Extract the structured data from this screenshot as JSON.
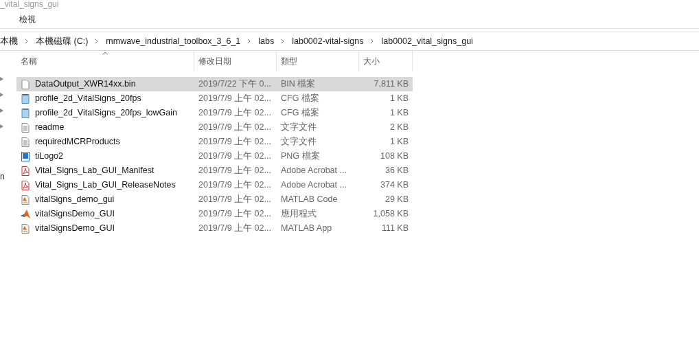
{
  "window": {
    "title": "_vital_signs_gui"
  },
  "ribbon_tabs": [
    {
      "label": "檢視",
      "selected": false
    }
  ],
  "breadcrumb": [
    "本機",
    "本機磁碟 (C:)",
    "mmwave_industrial_toolbox_3_6_1",
    "labs",
    "lab0002-vital-signs",
    "lab0002_vital_signs_gui"
  ],
  "sidebar": {
    "pins": [
      {
        "kind": "arrow"
      },
      {
        "kind": "arrow"
      },
      {
        "kind": "arrow"
      },
      {
        "kind": "arrow"
      }
    ],
    "partial_text": "n"
  },
  "table": {
    "columns": [
      {
        "label": "名稱",
        "sorted": true
      },
      {
        "label": "修改日期",
        "sorted": false
      },
      {
        "label": "類型",
        "sorted": false
      },
      {
        "label": "大小",
        "sorted": false
      }
    ],
    "rows": [
      {
        "kind": "blank",
        "name": "DataOutput_XWR14xx.bin",
        "date": "2019/7/22 下午 0...",
        "type": "BIN 檔案",
        "size": "7,811 KB",
        "selected": true
      },
      {
        "kind": "config",
        "name": "profile_2d_VitalSigns_20fps",
        "date": "2019/7/9 上午 02...",
        "type": "CFG 檔案",
        "size": "1 KB",
        "selected": false
      },
      {
        "kind": "config",
        "name": "profile_2d_VitalSigns_20fps_lowGain",
        "date": "2019/7/9 上午 02...",
        "type": "CFG 檔案",
        "size": "1 KB",
        "selected": false
      },
      {
        "kind": "text",
        "name": "readme",
        "date": "2019/7/9 上午 02...",
        "type": "文字文件",
        "size": "2 KB",
        "selected": false
      },
      {
        "kind": "text",
        "name": "requiredMCRProducts",
        "date": "2019/7/9 上午 02...",
        "type": "文字文件",
        "size": "1 KB",
        "selected": false
      },
      {
        "kind": "image",
        "name": "tiLogo2",
        "date": "2019/7/9 上午 02...",
        "type": "PNG 檔案",
        "size": "108 KB",
        "selected": false
      },
      {
        "kind": "pdf",
        "name": "Vital_Signs_Lab_GUI_Manifest",
        "date": "2019/7/9 上午 02...",
        "type": "Adobe Acrobat ...",
        "size": "36 KB",
        "selected": false
      },
      {
        "kind": "pdf",
        "name": "Vital_Signs_Lab_GUI_ReleaseNotes",
        "date": "2019/7/9 上午 02...",
        "type": "Adobe Acrobat ...",
        "size": "374 KB",
        "selected": false
      },
      {
        "kind": "code",
        "name": "vitalSigns_demo_gui",
        "date": "2019/7/9 上午 02...",
        "type": "MATLAB Code",
        "size": "29 KB",
        "selected": false
      },
      {
        "kind": "app",
        "name": "vitalSignsDemo_GUI",
        "date": "2019/7/9 上午 02...",
        "type": "應用程式",
        "size": "1,058 KB",
        "selected": false
      },
      {
        "kind": "code",
        "name": "vitalSignsDemo_GUI",
        "date": "2019/7/9 上午 02...",
        "type": "MATLAB App",
        "size": "111 KB",
        "selected": false
      }
    ]
  }
}
